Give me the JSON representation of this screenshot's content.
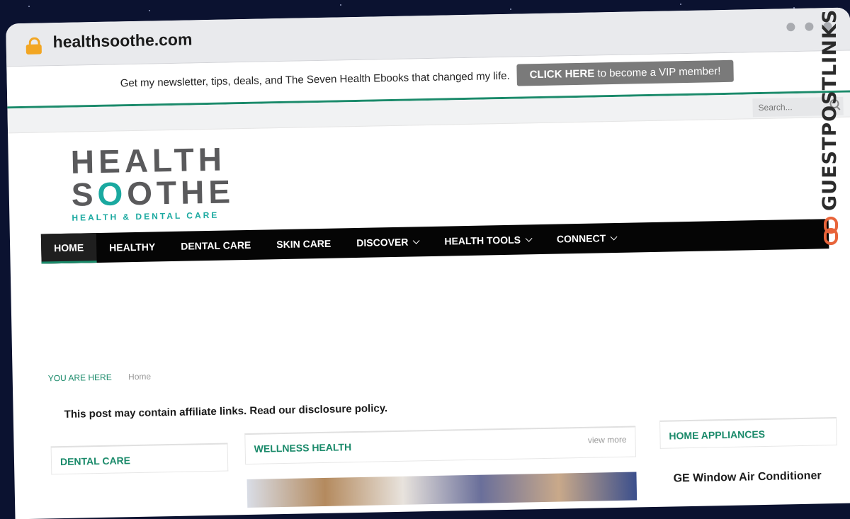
{
  "browser": {
    "url": "healthsoothe.com"
  },
  "topbar": {
    "text": "Get my newsletter, tips, deals, and The Seven Health Ebooks that changed my life.",
    "cta_bold": "CLICK HERE",
    "cta_rest": " to become a VIP member!"
  },
  "search": {
    "placeholder": "Search..."
  },
  "logo": {
    "line1": "HEALTH",
    "line2_pre": "S",
    "line2_o": "O",
    "line2_post": "OTHE",
    "tagline": "HEALTH & DENTAL CARE"
  },
  "nav": {
    "items": [
      {
        "label": "HOME"
      },
      {
        "label": "HEALTHY"
      },
      {
        "label": "DENTAL CARE"
      },
      {
        "label": "SKIN CARE"
      },
      {
        "label": "DISCOVER"
      },
      {
        "label": "HEALTH TOOLS"
      },
      {
        "label": "CONNECT"
      }
    ]
  },
  "breadcrumb": {
    "label": "YOU ARE HERE",
    "home": "Home"
  },
  "disclosure": "This post may contain affiliate links. Read our disclosure policy.",
  "sections": {
    "left_title": "DENTAL CARE",
    "mid_title": "WELLNESS HEALTH",
    "mid_view_more": "view more",
    "right_title": "HOME APPLIANCES",
    "right_article": "GE Window Air Conditioner"
  },
  "watermark": {
    "text": "GUESTPOSTLINKS"
  },
  "colors": {
    "accent": "#1a8a6a",
    "nav_bg": "#050505",
    "cta_bg": "#7a7a7a",
    "logo_teal": "#1aa9a0"
  }
}
